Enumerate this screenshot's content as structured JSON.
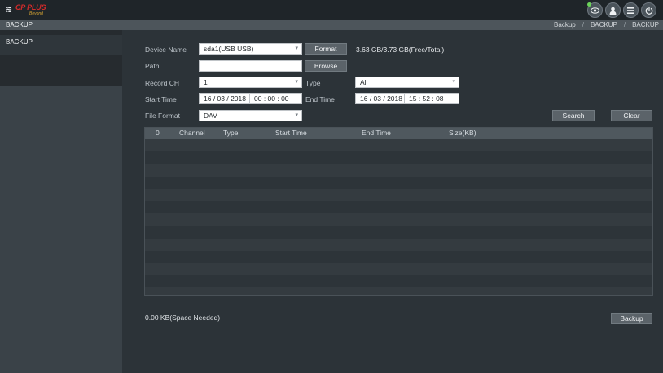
{
  "app": {
    "brand_mark": "≋",
    "brand_name": "CP PLUS",
    "brand_tagline": "Beyond",
    "window_title": "BACKUP"
  },
  "breadcrumb": [
    "Backup",
    "BACKUP",
    "BACKUP"
  ],
  "breadcrumb_separator": "/",
  "top_icons": [
    "eye-icon",
    "user-icon",
    "menu-icon",
    "power-icon"
  ],
  "sidebar": {
    "items": [
      {
        "label": "BACKUP",
        "active": true
      }
    ]
  },
  "form": {
    "device_name": {
      "label": "Device Name",
      "value": "sda1(USB USB)"
    },
    "format_button": "Format",
    "storage_info": "3.63 GB/3.73 GB(Free/Total)",
    "path": {
      "label": "Path",
      "value": ""
    },
    "browse_button": "Browse",
    "record_ch": {
      "label": "Record CH",
      "value": "1"
    },
    "type": {
      "label": "Type",
      "value": "All"
    },
    "start_time": {
      "label": "Start Time",
      "date": "16 / 03 / 2018",
      "time": "00 : 00 : 00"
    },
    "end_time": {
      "label": "End Time",
      "date": "16 / 03 / 2018",
      "time": "15 : 52 : 08"
    },
    "file_format": {
      "label": "File Format",
      "value": "DAV"
    },
    "search_button": "Search",
    "clear_button": "Clear"
  },
  "table": {
    "columns": [
      "0",
      "Channel",
      "Type",
      "Start Time",
      "End Time",
      "Size(KB)"
    ],
    "rows": []
  },
  "footer": {
    "space_needed": "0.00 KB(Space Needed)",
    "backup_button": "Backup"
  },
  "colors": {
    "background": "#2b3238",
    "topbar": "#1f2529",
    "titlebar": "#4d555b",
    "brand_red": "#d42b2b",
    "notification_green": "#6bd35a"
  }
}
